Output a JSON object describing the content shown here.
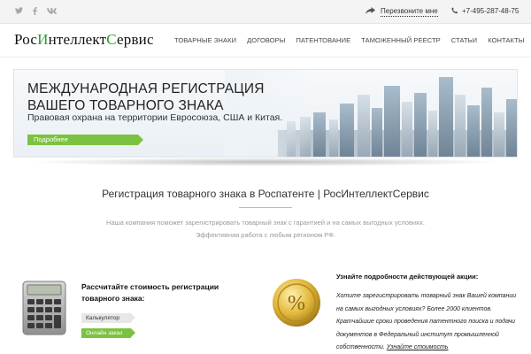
{
  "topbar": {
    "social": [
      {
        "name": "twitter-icon",
        "glyph": "🐦"
      },
      {
        "name": "facebook-icon",
        "glyph": "f"
      },
      {
        "name": "vk-icon",
        "glyph": "vk"
      }
    ],
    "callback_label": "Перезвоните мне",
    "phone": "+7-495-287-48-75"
  },
  "header": {
    "logo": {
      "p1": "Рос",
      "p2": "И",
      "p3": "нтеллект",
      "p4": "С",
      "p5": "ервис"
    },
    "nav": [
      "ТОВАРНЫЕ ЗНАКИ",
      "ДОГОВОРЫ",
      "ПАТЕНТОВАНИЕ",
      "ТАМОЖЕННЫЙ РЕЕСТР",
      "СТАТЬИ",
      "КОНТАКТЫ"
    ]
  },
  "banner": {
    "title_line1": "МЕЖДУНАРОДНАЯ РЕГИСТРАЦИЯ",
    "title_line2": "ВАШЕГО ТОВАРНОГО ЗНАКА",
    "subtitle": "Правовая охрана на территории Евросоюза, США и Китая.",
    "button": "Подробнее"
  },
  "intro": {
    "headline": "Регистрация товарного знака в Роспатенте | РосИнтеллектСервис",
    "desc_line1": "Наша компания поможет зарегистрировать товарный знак с гарантией и на самых выгодных условиях.",
    "desc_line2": "Эффективная работа с любым регионом РФ."
  },
  "calculator": {
    "title": "Рассчитайте стоимость регистрации товарного знака:",
    "calc_button": "Калькулятор",
    "order_button": "Онлайн заказ"
  },
  "promo": {
    "title": "Узнайте подробности действующей акции:",
    "text": "Хотите зарегистрировать товарный знак Вашей компании на самых выгодных условиях? Более 2000 клиентов. Кратчайшие сроки проведения патентного поиска и подачи документов в Федеральный институт промышленной собственности.",
    "link": "Узнайте стоимость"
  },
  "colors": {
    "accent": "#7cc242",
    "logo_green": "#2e9d2e"
  }
}
